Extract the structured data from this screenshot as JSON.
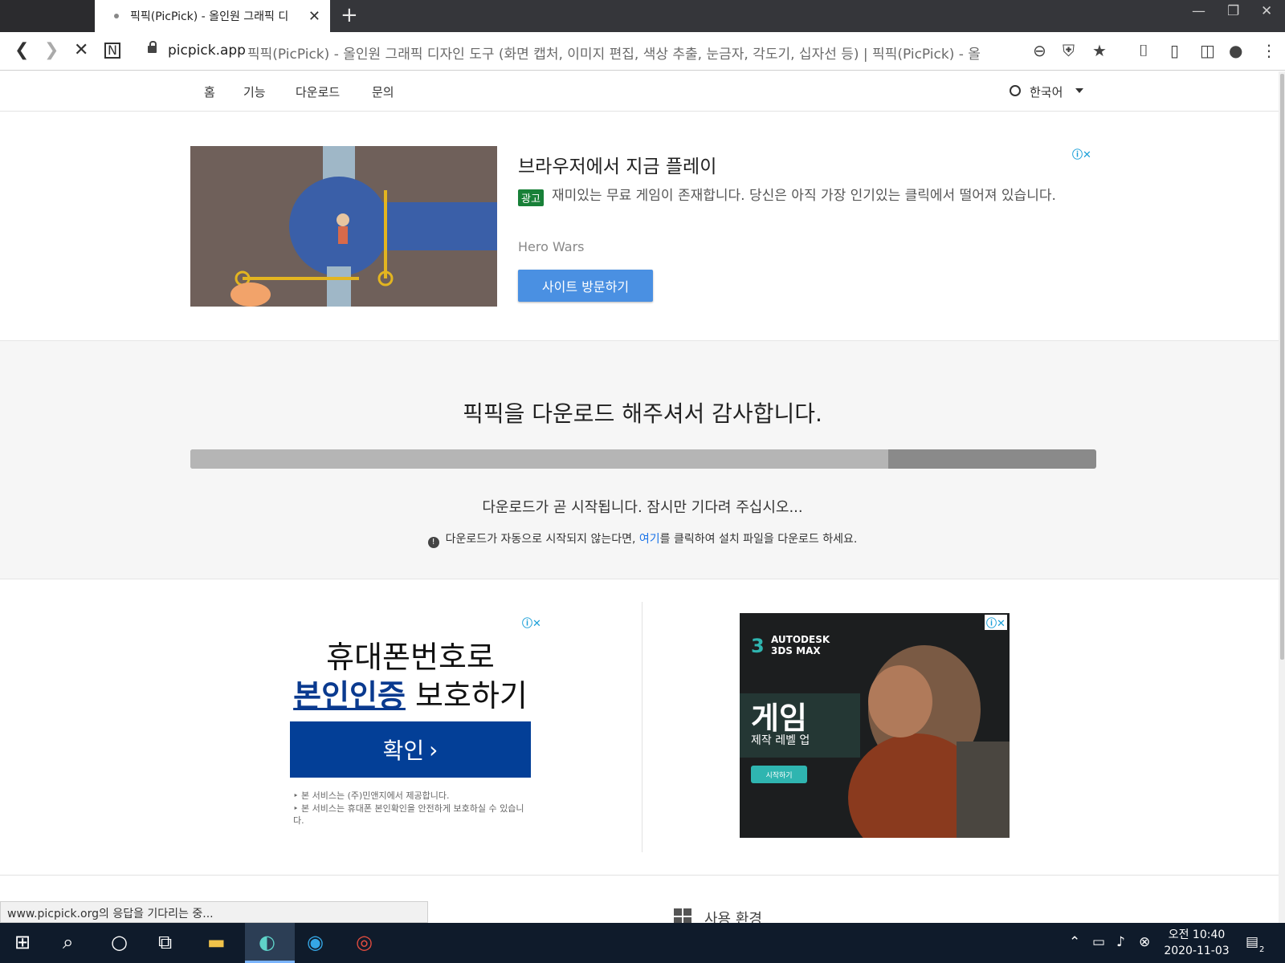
{
  "browser": {
    "tab_title": "픽픽(PicPick) - 올인원 그래픽 디",
    "url_host": "picpick.app",
    "url_rest": "픽픽(PicPick) - 올인원 그래픽 디자인 도구 (화면 캡처, 이미지 편집, 색상 추출, 눈금자, 각도기, 십자선 등) | 픽픽(PicPick) - 올"
  },
  "nav": {
    "items": [
      "홈",
      "기능",
      "다운로드",
      "문의"
    ],
    "language": "한국어"
  },
  "ad_top": {
    "title": "브라우저에서 지금 플레이",
    "badge": "광고",
    "description": "재미있는 무료 게임이 존재합니다. 당신은 아직 가장 인기있는 클릭에서 떨어져 있습니다.",
    "advertiser": "Hero Wars",
    "button": "사이트 방문하기"
  },
  "download": {
    "title": "픽픽을 다운로드 해주셔서 감사합니다.",
    "progress": 0.77,
    "subtitle": "다운로드가 곧 시작됩니다. 잠시만 기다려 주십시오...",
    "note_before": "다운로드가 자동으로 시작되지 않는다면,",
    "note_link": "여기",
    "note_after": "를 클릭하여 설치 파일을 다운로드 하세요."
  },
  "ad_left": {
    "line1": "휴대폰번호로",
    "highlight": "본인인증",
    "line2_rest": " 보호하기",
    "button": "확인",
    "notes": [
      "본 서비스는 (주)민앤지에서 제공합니다.",
      "본 서비스는 휴대폰 본인확인을 안전하게 보호하실 수 있습니다."
    ]
  },
  "ad_right": {
    "brand_line1": "AUTODESK",
    "brand_line2": "3DS MAX",
    "headline": "게임",
    "sub": "제작 레벨 업",
    "button": "시작하기"
  },
  "bottom": {
    "section_title": "사용 환경",
    "status": "www.picpick.org의 응답을 기다리는 중..."
  },
  "taskbar": {
    "time": "오전 10:40",
    "date": "2020-11-03",
    "notifications": "2"
  },
  "colors": {
    "ad_button": "#4a90e2",
    "ad_badge": "#188038",
    "confirm_button": "#033f97",
    "taskbar": "#0f1b2b"
  }
}
